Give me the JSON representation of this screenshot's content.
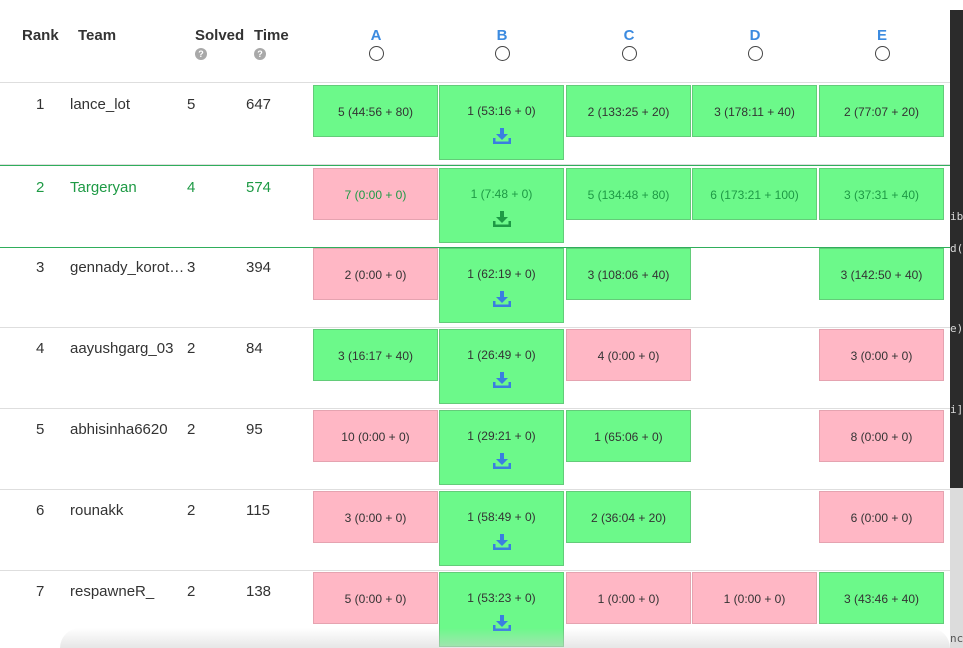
{
  "columns": {
    "rank": "Rank",
    "team": "Team",
    "solved": "Solved",
    "time": "Time",
    "help_glyph": "?"
  },
  "problems": [
    "A",
    "B",
    "C",
    "D",
    "E"
  ],
  "rows": [
    {
      "rank": "1",
      "team": "lance_lot",
      "solved": "5",
      "time": "647",
      "cells": [
        {
          "text": "5 (44:56 + 80)",
          "status": "ok"
        },
        {
          "text": "1 (53:16 + 0)",
          "status": "ok",
          "download": true
        },
        {
          "text": "2 (133:25 + 20)",
          "status": "ok"
        },
        {
          "text": "3 (178:11 + 40)",
          "status": "ok"
        },
        {
          "text": "2 (77:07 + 20)",
          "status": "ok"
        }
      ]
    },
    {
      "rank": "2",
      "team": "Targeryan",
      "solved": "4",
      "time": "574",
      "highlight": true,
      "cells": [
        {
          "text": "7 (0:00 + 0)",
          "status": "bad"
        },
        {
          "text": "1 (7:48 + 0)",
          "status": "ok",
          "download": true
        },
        {
          "text": "5 (134:48 + 80)",
          "status": "ok"
        },
        {
          "text": "6 (173:21 + 100)",
          "status": "ok"
        },
        {
          "text": "3 (37:31 + 40)",
          "status": "ok"
        }
      ]
    },
    {
      "rank": "3",
      "team": "gennady_korotkevich",
      "solved": "3",
      "time": "394",
      "cells": [
        {
          "text": "2 (0:00 + 0)",
          "status": "bad"
        },
        {
          "text": "1 (62:19 + 0)",
          "status": "ok",
          "download": true
        },
        {
          "text": "3 (108:06 + 40)",
          "status": "ok"
        },
        null,
        {
          "text": "3 (142:50 + 40)",
          "status": "ok"
        }
      ]
    },
    {
      "rank": "4",
      "team": "aayushgarg_03",
      "solved": "2",
      "time": "84",
      "cells": [
        {
          "text": "3 (16:17 + 40)",
          "status": "ok"
        },
        {
          "text": "1 (26:49 + 0)",
          "status": "ok",
          "download": true
        },
        {
          "text": "4 (0:00 + 0)",
          "status": "bad"
        },
        null,
        {
          "text": "3 (0:00 + 0)",
          "status": "bad"
        }
      ]
    },
    {
      "rank": "5",
      "team": "abhisinha6620",
      "solved": "2",
      "time": "95",
      "cells": [
        {
          "text": "10 (0:00 + 0)",
          "status": "bad"
        },
        {
          "text": "1 (29:21 + 0)",
          "status": "ok",
          "download": true
        },
        {
          "text": "1 (65:06 + 0)",
          "status": "ok"
        },
        null,
        {
          "text": "8 (0:00 + 0)",
          "status": "bad"
        }
      ]
    },
    {
      "rank": "6",
      "team": "rounakk",
      "solved": "2",
      "time": "115",
      "cells": [
        {
          "text": "3 (0:00 + 0)",
          "status": "bad"
        },
        {
          "text": "1 (58:49 + 0)",
          "status": "ok",
          "download": true
        },
        {
          "text": "2 (36:04 + 20)",
          "status": "ok"
        },
        null,
        {
          "text": "6 (0:00 + 0)",
          "status": "bad"
        }
      ]
    },
    {
      "rank": "7",
      "team": "respawneR_",
      "solved": "2",
      "time": "138",
      "cells": [
        {
          "text": "5 (0:00 + 0)",
          "status": "bad"
        },
        {
          "text": "1 (53:23 + 0)",
          "status": "ok",
          "download": true
        },
        {
          "text": "1 (0:00 + 0)",
          "status": "bad"
        },
        {
          "text": "1 (0:00 + 0)",
          "status": "bad"
        },
        {
          "text": "3 (43:46 + 40)",
          "status": "ok"
        }
      ]
    }
  ],
  "colors": {
    "accepted": "#6cf98a",
    "rejected": "#ffb7c5",
    "highlight_text": "#1e9a45",
    "problem_letter": "#3c8be0",
    "download_icon": "#3a7ee0"
  },
  "icons": {
    "help": "question-circle-icon",
    "download": "download-icon"
  }
}
